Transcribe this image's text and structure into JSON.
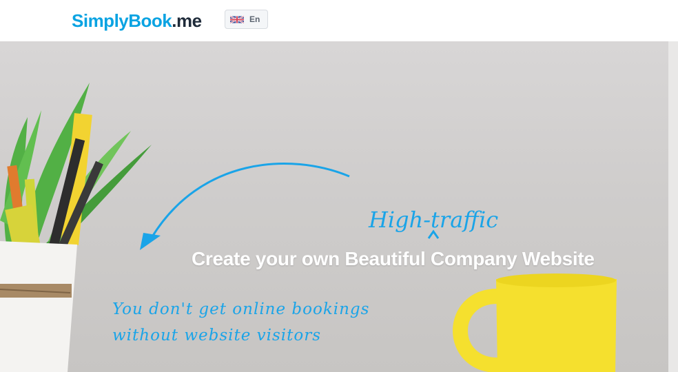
{
  "header": {
    "logo": {
      "main": "SimplyBook",
      "tld": ".me"
    },
    "language": {
      "code": "En",
      "flag_icon": "uk-flag-icon"
    }
  },
  "hero": {
    "headline": "Create your own Beautiful Company Website",
    "annotation_top": "High-traffic",
    "annotation_bottom_line1": "You don't get online bookings",
    "annotation_bottom_line2": "without website visitors"
  },
  "colors": {
    "brand_blue": "#0aa3e2",
    "brand_dark": "#1f2b3a",
    "annotation_blue": "#1aa4e8",
    "cup_yellow": "#f5e02e"
  }
}
